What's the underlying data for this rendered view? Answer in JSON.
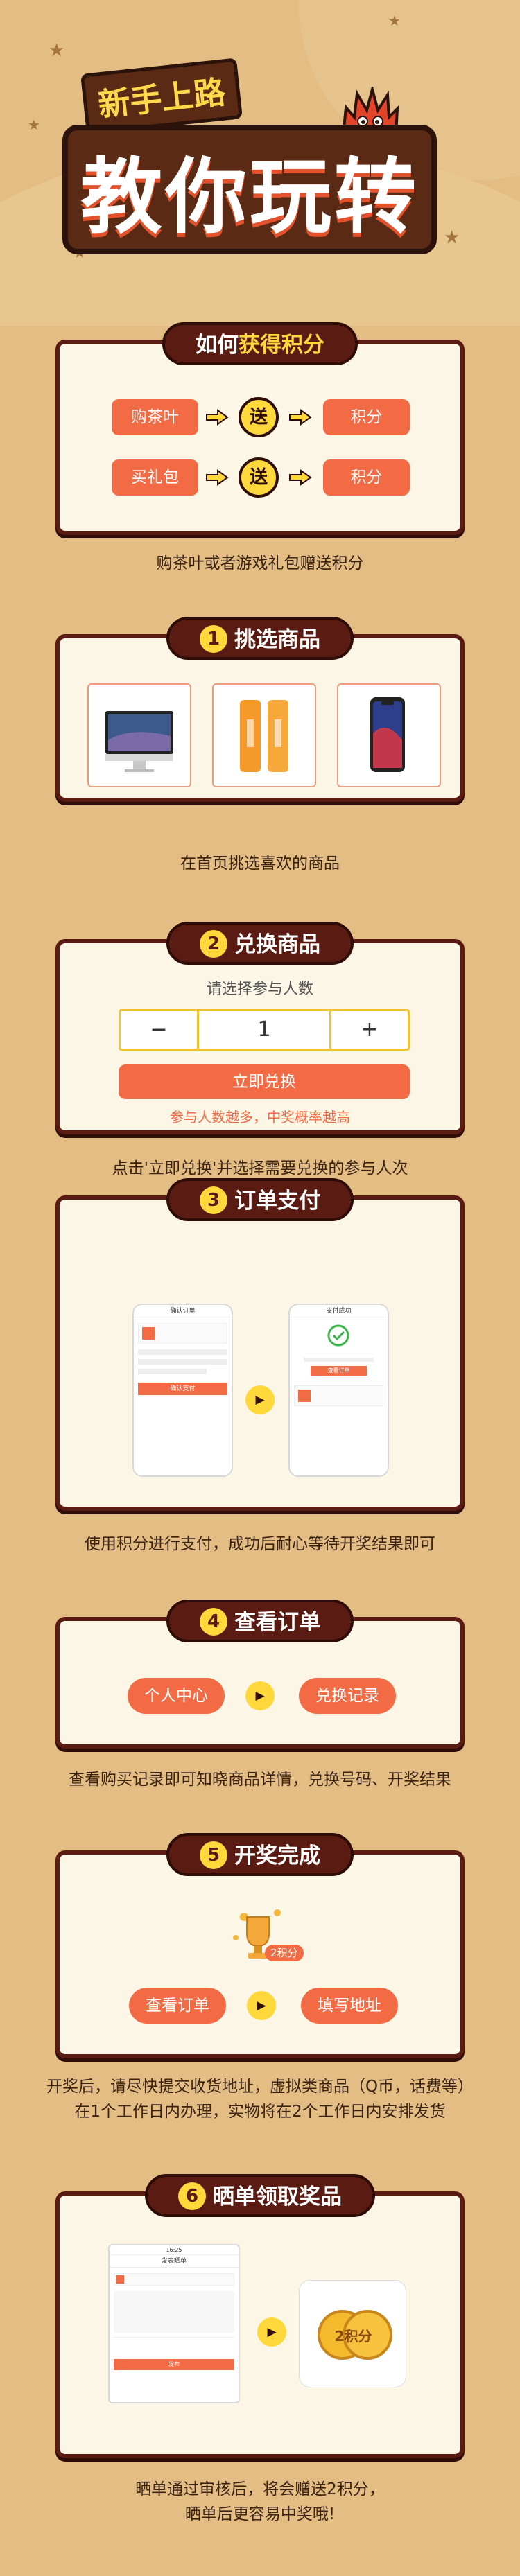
{
  "hero": {
    "subtitle": "新手上路",
    "title": "教你玩转"
  },
  "colors": {
    "background": "#e3bd84",
    "card": "#fcf6e7",
    "dark": "#5a1b12",
    "accent": "#f26b45",
    "yellow": "#ffd83b"
  },
  "step0": {
    "title_pre": "如何",
    "title_hl": "获得积分",
    "rows": [
      {
        "from": "购茶叶",
        "send": "送",
        "to": "积分"
      },
      {
        "from": "买礼包",
        "send": "送",
        "to": "积分"
      }
    ],
    "caption": "购茶叶或者游戏礼包赠送积分"
  },
  "step1": {
    "num": "1",
    "title": "挑选商品",
    "products": [
      "imac-computer",
      "power-bank",
      "smartphone"
    ],
    "caption": "在首页挑选喜欢的商品"
  },
  "step2": {
    "num": "2",
    "title": "兑换商品",
    "prompt": "请选择参与人数",
    "minus": "−",
    "qty": "1",
    "plus": "+",
    "button": "立即兑换",
    "hint": "参与人数越多，中奖概率越高",
    "caption": "点击'立即兑换'并选择需要兑换的参与人次"
  },
  "step3": {
    "num": "3",
    "title": "订单支付",
    "phone1_title": "确认订单",
    "phone1_btn": "确认支付",
    "phone2_title": "支付成功",
    "phone2_btn": "查看订单",
    "caption": "使用积分进行支付，成功后耐心等待开奖结果即可"
  },
  "step4": {
    "num": "4",
    "title": "查看订单",
    "left": "个人中心",
    "right": "兑换记录",
    "caption": "查看购买记录即可知晓商品详情，兑换号码、开奖结果"
  },
  "step5": {
    "num": "5",
    "title": "开奖完成",
    "left": "查看订单",
    "right": "填写地址",
    "badge": "2积分",
    "caption_line1": "开奖后，请尽快提交收货地址，虚拟类商品（Q币，话费等）",
    "caption_line2": "在1个工作日内办理，实物将在2个工作日内安排发货"
  },
  "step6": {
    "num": "6",
    "title": "晒单领取奖品",
    "phone_title": "发表晒单",
    "phone_time": "16:25",
    "phone_btn": "发布",
    "coin_text": "2积分",
    "caption_line1": "晒单通过审核后，将会赠送2积分，",
    "caption_line2": "晒单后更容易中奖哦!"
  }
}
